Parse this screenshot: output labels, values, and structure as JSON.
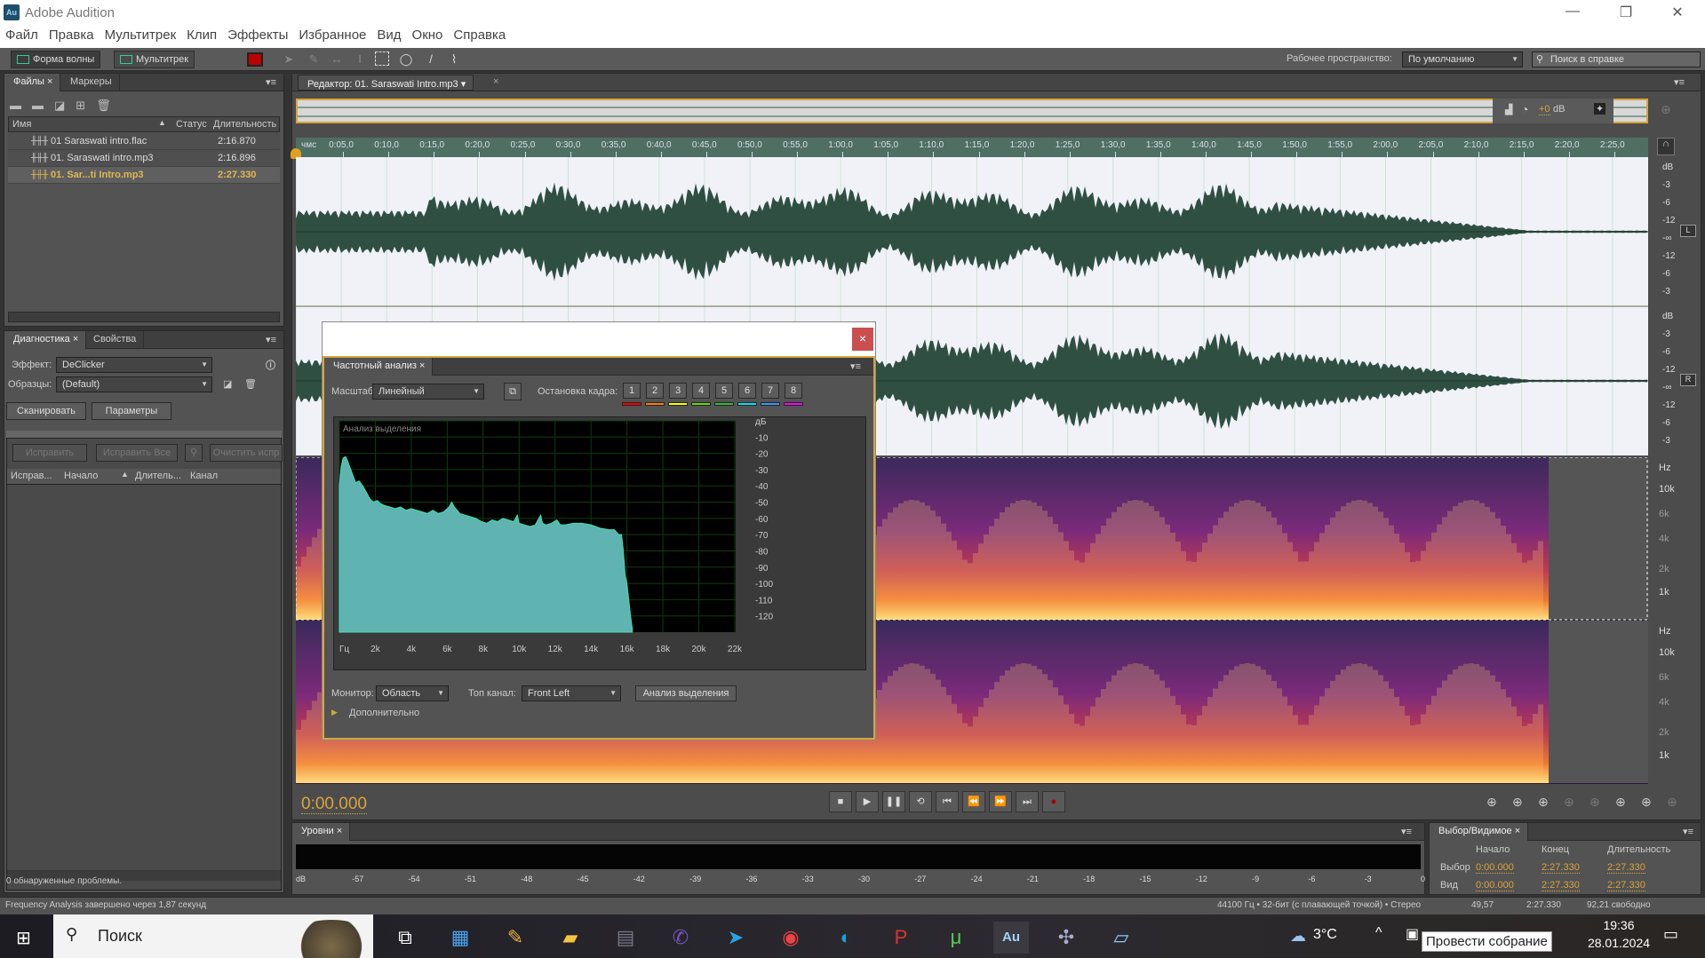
{
  "window": {
    "title": "Adobe Audition",
    "logo": "Au",
    "minimize": "—",
    "maximize": "❐",
    "close": "✕"
  },
  "menu": [
    "Файл",
    "Правка",
    "Мультитрек",
    "Клип",
    "Эффекты",
    "Избранное",
    "Вид",
    "Окно",
    "Справка"
  ],
  "toolbar": {
    "waveform_label": "Форма волны",
    "multitrack_label": "Мультитрек",
    "workspace_label": "Рабочее пространство:",
    "workspace_value": "По умолчанию",
    "help_search_placeholder": "Поиск в справке"
  },
  "files_panel": {
    "tabs": [
      "Файлы",
      "Маркеры"
    ],
    "columns": [
      "Имя",
      "Статус",
      "Длительность"
    ],
    "rows": [
      {
        "name": "01 Saraswati intro.flac",
        "status": "",
        "duration": "2:16.870",
        "selected": false
      },
      {
        "name": "01. Saraswati intro.mp3",
        "status": "",
        "duration": "2:16.896",
        "selected": false
      },
      {
        "name": "01. Sar...ti Intro.mp3",
        "status": "",
        "duration": "2:27.330",
        "selected": true
      }
    ]
  },
  "diagnostics_panel": {
    "tabs": [
      "Диагностика",
      "Свойства"
    ],
    "effect_label": "Эффект:",
    "effect_value": "DeClicker",
    "presets_label": "Образцы:",
    "presets_value": "(Default)",
    "scan_button": "Сканировать",
    "params_button": "Параметры",
    "fix_button": "Исправить",
    "fix_all_button": "Исправить Все",
    "clear_button": "Очистить испр",
    "columns": [
      "Исправ...",
      "Начало",
      "Длитель...",
      "Канал"
    ],
    "status": "0 обнаруженные проблемы."
  },
  "editor": {
    "tab_label": "Редактор: 01. Saraswati Intro.mp3",
    "gain_value": "+0",
    "gain_unit": "dB",
    "ruler_labels": [
      "чмс",
      "0:05,0",
      "0:10,0",
      "0:15,0",
      "0:20,0",
      "0:25,0",
      "0:30,0",
      "0:35,0",
      "0:40,0",
      "0:45,0",
      "0:50,0",
      "0:55,0",
      "1:00,0",
      "1:05,0",
      "1:10,0",
      "1:15,0",
      "1:20,0",
      "1:25,0",
      "1:30,0",
      "1:35,0",
      "1:40,0",
      "1:45,0",
      "1:50,0",
      "1:55,0",
      "2:00,0",
      "2:05,0",
      "2:10,0",
      "2:15,0",
      "2:20,0",
      "2:25,0"
    ],
    "db_scale": [
      "dB",
      "-3",
      "-6",
      "-12",
      "-∞",
      "-12",
      "-6",
      "-3"
    ],
    "channels": [
      "L",
      "R"
    ],
    "hz_scale": [
      "Hz",
      "10k",
      "6k",
      "4k",
      "2k",
      "1k"
    ],
    "time_display": "0:00.000"
  },
  "freq_dialog": {
    "close": "×",
    "tab": "Частотный анализ",
    "scale_label": "Масштаб:",
    "scale_value": "Линейный",
    "freeze_label": "Остановка кадра:",
    "freeze_buttons": [
      "1",
      "2",
      "3",
      "4",
      "5",
      "6",
      "7",
      "8"
    ],
    "freeze_colors": [
      "#ff0000",
      "#ff7f00",
      "#ffff00",
      "#66dd00",
      "#33bb33",
      "#00e5ff",
      "#3399ff",
      "#ff00ff"
    ],
    "monitor_label": "Монитор:",
    "monitor_value": "Область",
    "channel_label": "Топ канал:",
    "channel_value": "Front Left",
    "analyze_button": "Анализ выделения",
    "advanced_label": "Дополнительно"
  },
  "chart_data": {
    "type": "area",
    "title": "Анализ выделения",
    "xlabel": "Гц",
    "ylabel": "дБ",
    "xlim": [
      0,
      22050
    ],
    "ylim": [
      -130,
      0
    ],
    "x_ticks": [
      "Гц",
      "2k",
      "4k",
      "6k",
      "8k",
      "10k",
      "12k",
      "14k",
      "16k",
      "18k",
      "20k",
      "22k"
    ],
    "y_ticks": [
      "дБ",
      "-10",
      "-20",
      "-30",
      "-40",
      "-50",
      "-60",
      "-70",
      "-80",
      "-90",
      "-100",
      "-110",
      "-120"
    ],
    "series": [
      {
        "name": "Front Left",
        "color": "#5fb3b0",
        "x": [
          0,
          100,
          200,
          350,
          500,
          700,
          900,
          1100,
          1300,
          1500,
          1700,
          1900,
          2100,
          2300,
          2500,
          2800,
          3100,
          3400,
          3700,
          4000,
          4300,
          4600,
          4900,
          5200,
          5500,
          5800,
          6100,
          6250,
          6400,
          6700,
          7000,
          7300,
          7600,
          7900,
          8200,
          8500,
          8800,
          9100,
          9400,
          9700,
          9900,
          10000,
          10300,
          10600,
          10900,
          11200,
          11300,
          11500,
          11800,
          12100,
          12300,
          12600,
          13000,
          13500,
          14000,
          14500,
          15000,
          15300,
          15550,
          15700,
          15800,
          15900,
          16000,
          16100,
          16200,
          16300
        ],
        "y": [
          -40,
          -28,
          -23,
          -22,
          -26,
          -32,
          -38,
          -37,
          -40,
          -44,
          -48,
          -50,
          -49,
          -51,
          -52,
          -53,
          -54,
          -53,
          -55,
          -54,
          -55,
          -56,
          -57,
          -55,
          -57,
          -56,
          -53,
          -50,
          -53,
          -57,
          -58,
          -59,
          -60,
          -62,
          -63,
          -61,
          -62,
          -60,
          -61,
          -62,
          -58,
          -63,
          -64,
          -65,
          -64,
          -58,
          -63,
          -64,
          -63,
          -61,
          -64,
          -64,
          -63,
          -63,
          -64,
          -66,
          -67,
          -67,
          -70,
          -70,
          -80,
          -95,
          -100,
          -110,
          -120,
          -128
        ]
      }
    ]
  },
  "levels_panel": {
    "tab": "Уровни",
    "scale": [
      "dB",
      "-57",
      "-54",
      "-51",
      "-48",
      "-45",
      "-42",
      "-39",
      "-36",
      "-33",
      "-30",
      "-27",
      "-24",
      "-21",
      "-18",
      "-15",
      "-12",
      "-9",
      "-6",
      "-3",
      "0"
    ]
  },
  "selection_panel": {
    "tab": "Выбор/Видимое",
    "columns": [
      "Начало",
      "Конец",
      "Длительность"
    ],
    "rows": [
      {
        "label": "Выбор",
        "start": "0:00.000",
        "end": "2:27.330",
        "duration": "2:27.330"
      },
      {
        "label": "Вид",
        "start": "0:00.000",
        "end": "2:27.330",
        "duration": "2:27.330"
      }
    ]
  },
  "statusbar": {
    "message": "Frequency Analysis завершено через 1,87 секунд",
    "format": "44100 Гц • 32-бит (с плавающей точкой) • Стерео",
    "size": "49,57",
    "duration": "2:27.330",
    "free": "92,21  свободно"
  },
  "taskbar": {
    "search": "Поиск",
    "weather": "3°C",
    "time": "19:36",
    "date": "28.01.2024",
    "tooltip": "Провести собрание"
  }
}
